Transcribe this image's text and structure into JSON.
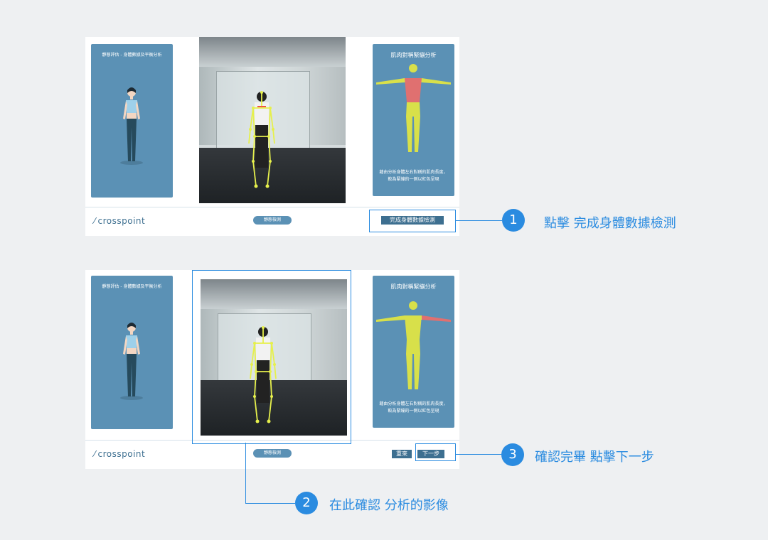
{
  "screens": [
    {
      "left_panel_title": "靜態評估 - 身體數據及平衡分析",
      "right_panel_title": "肌肉對稱緊繃分析",
      "right_panel_desc": "藉由分析身體左右對稱的肌肉長度，較為緊繃的一側以紅色呈現",
      "logo": "crosspoint",
      "mode_pill": "靜態檢測",
      "complete_button": "完成身體數據檢測"
    },
    {
      "left_panel_title": "靜態評估 - 身體數據及平衡分析",
      "right_panel_title": "肌肉對稱緊繃分析",
      "right_panel_desc": "藉由分析身體左右對稱的肌肉長度，較為緊繃的一側以紅色呈現",
      "logo": "crosspoint",
      "mode_pill": "靜態檢測",
      "reset_button": "重來",
      "next_button": "下一步"
    }
  ],
  "annotations": [
    {
      "number": "1",
      "text": "點擊 完成身體數據檢測"
    },
    {
      "number": "2",
      "text": "在此確認 分析的影像"
    },
    {
      "number": "3",
      "text": "確認完畢 點擊下一步"
    }
  ],
  "colors": {
    "panel": "#5b91b5",
    "accent": "#2a8be0",
    "button": "#3d6f90",
    "muscle_tight": "#e07070",
    "muscle": "#d8e04a"
  }
}
